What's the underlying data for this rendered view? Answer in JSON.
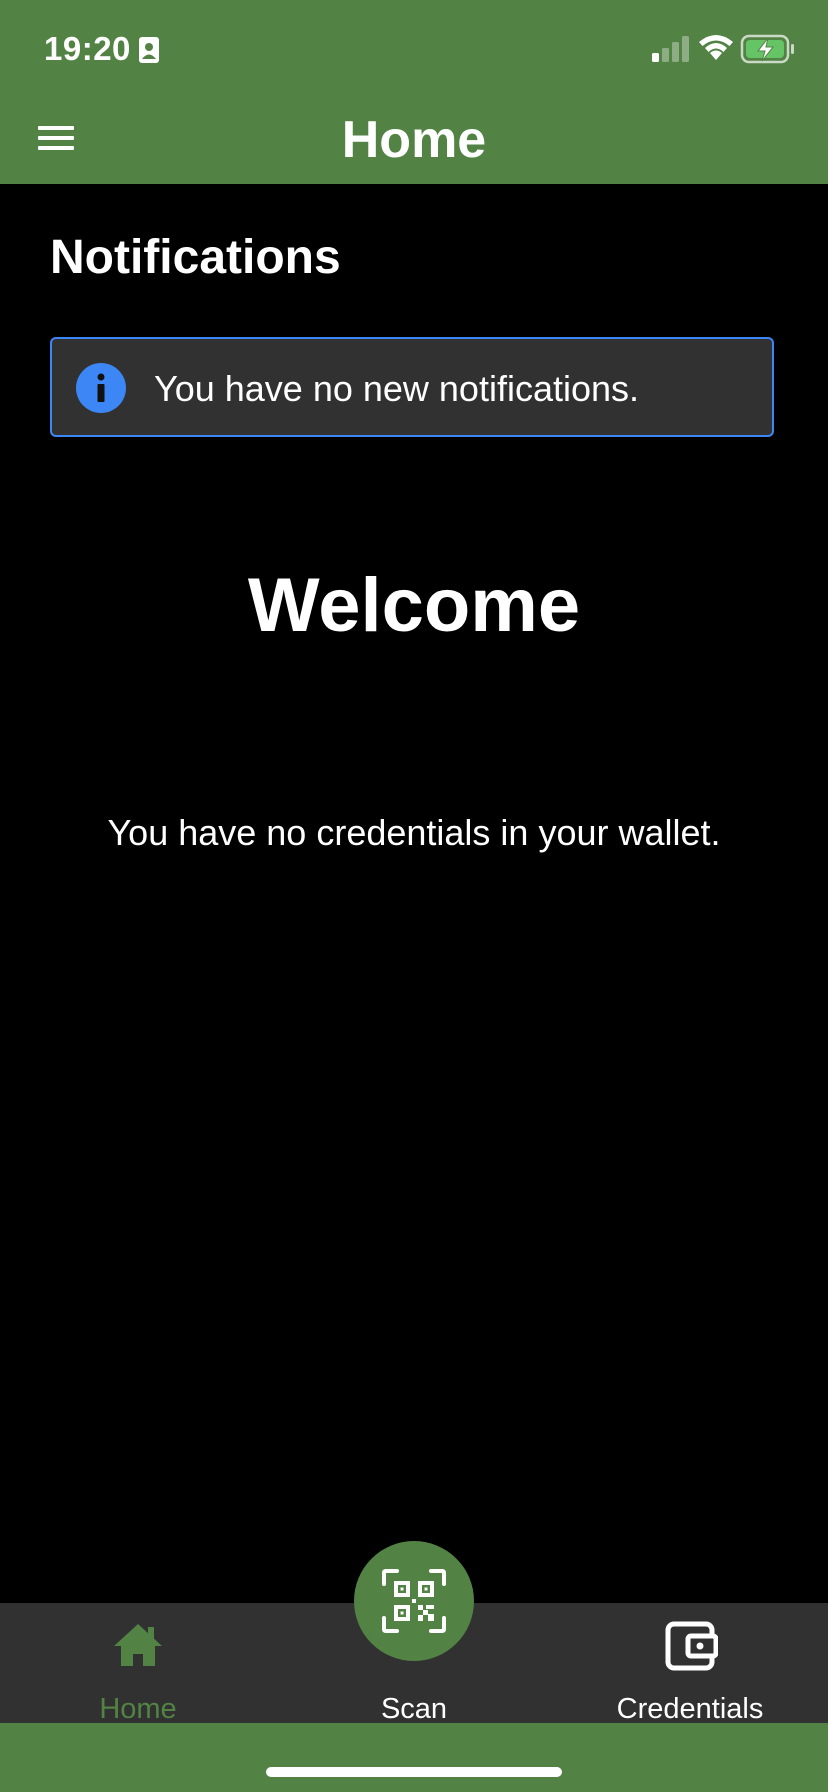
{
  "status_bar": {
    "time": "19:20"
  },
  "header": {
    "title": "Home",
    "menu_icon": "hamburger-menu-icon"
  },
  "notifications": {
    "title": "Notifications",
    "message": "You have no new notifications.",
    "icon": "info-icon",
    "accent_color": "#3d86f5"
  },
  "main": {
    "welcome": "Welcome",
    "empty_message": "You have no credentials in your wallet."
  },
  "tabs": [
    {
      "label": "Home",
      "icon": "home-icon",
      "active": true
    },
    {
      "label": "Scan",
      "icon": "qr-code-icon",
      "active": false
    },
    {
      "label": "Credentials",
      "icon": "wallet-icon",
      "active": false
    }
  ],
  "colors": {
    "brand": "#528244",
    "background": "#000000",
    "surface": "#313131"
  }
}
